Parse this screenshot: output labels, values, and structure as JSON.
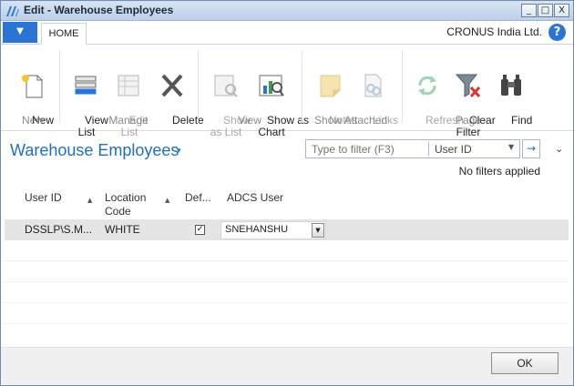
{
  "window": {
    "title": "Edit - Warehouse Employees",
    "minimize": "_",
    "maximize": "□",
    "close": "X"
  },
  "tabs": {
    "app_menu": "▼",
    "home": "HOME"
  },
  "company": "CRONUS India Ltd.",
  "help": "?",
  "ribbon": {
    "new": {
      "label": "New",
      "group": "New"
    },
    "manage": {
      "group": "Manage",
      "view_list": "View\nList",
      "edit_list": "Edit\nList",
      "delete": "Delete"
    },
    "view": {
      "group": "View",
      "show_as_list": "Show\nas List",
      "show_as_chart": "Show as\nChart"
    },
    "show_attached": {
      "group": "Show Attached",
      "notes": "Notes",
      "links": "Links"
    },
    "page": {
      "group": "Page",
      "refresh": "Refresh",
      "clear_filter": "Clear\nFilter",
      "find": "Find"
    }
  },
  "page": {
    "title": "Warehouse Employees",
    "title_arrow": "▾"
  },
  "filter": {
    "placeholder": "Type to filter (F3)",
    "field": "User ID",
    "go": "→",
    "status": "No filters applied",
    "collapse": "⌄"
  },
  "columns": [
    {
      "label": "User ID",
      "sorted": true
    },
    {
      "label": "Location\nCode",
      "sorted": true
    },
    {
      "label": "Def...",
      "sorted": false
    },
    {
      "label": "ADCS User",
      "sorted": false
    }
  ],
  "rows": [
    {
      "user_id": "DSSLP\\S.M...",
      "location_code": "WHITE",
      "default": true,
      "adcs_user": "SNEHANSHU"
    }
  ],
  "footer": {
    "ok": "OK"
  },
  "colors": {
    "accent": "#1f6fc0",
    "app_menu": "#2a74d6",
    "selected_row": "#e5e5e5"
  }
}
